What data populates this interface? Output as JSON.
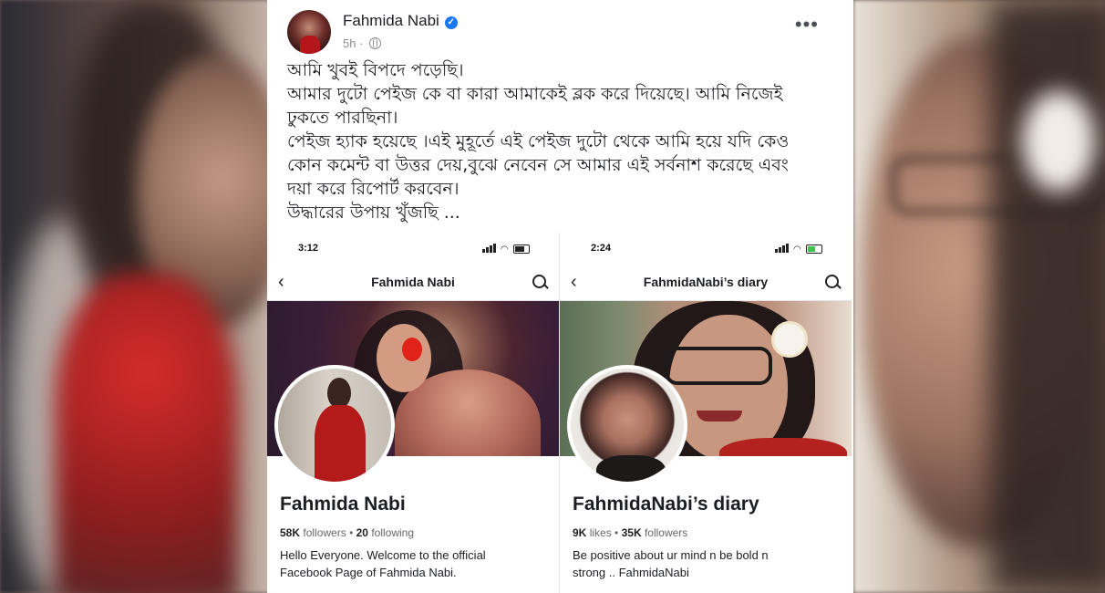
{
  "post": {
    "author": "Fahmida Nabi",
    "time": "5h",
    "more": "•••",
    "text_lines": [
      "আমি খুবই বিপদে পড়েছি।",
      "আমার দুটো পেইজ কে বা কারা আমাকেই ব্লক করে দিয়েছে। আমি নিজেই",
      "ঢুকতে পারছিনা।",
      "পেইজ হ্যাক হয়েছে ।এই মুহূর্তে এই পেইজ দুটো থেকে আমি হয়ে যদি কেও",
      "কোন কমেন্ট বা উত্তর দেয়,বুঝে নেবেন সে আমার এই সর্বনাশ করেছে এবং",
      "দয়া করে রিপোর্ট করবেন।",
      "উদ্ধারের উপায় খুঁজছি ..."
    ]
  },
  "screenshots": [
    {
      "time": "3:12",
      "nav_title": "Fahmida Nabi",
      "page_name": "Fahmida Nabi",
      "stat1_value": "58K",
      "stat1_label": "followers",
      "separator": "•",
      "stat2_value": "20",
      "stat2_label": "following",
      "bio_lines": [
        "Hello Everyone. Welcome to the official",
        "Facebook Page of Fahmida Nabi."
      ]
    },
    {
      "time": "2:24",
      "nav_title": "FahmidaNabi’s diary",
      "page_name": "FahmidaNabi’s diary",
      "stat1_value": "9K",
      "stat1_label": "likes",
      "separator": "•",
      "stat2_value": "35K",
      "stat2_label": "followers",
      "bio_lines": [
        "Be positive about ur mind n be bold n",
        "strong .. FahmidaNabi"
      ]
    }
  ],
  "colors": {
    "verified": "#1877f2",
    "text": "#1c1e21",
    "muted": "#65676b"
  }
}
